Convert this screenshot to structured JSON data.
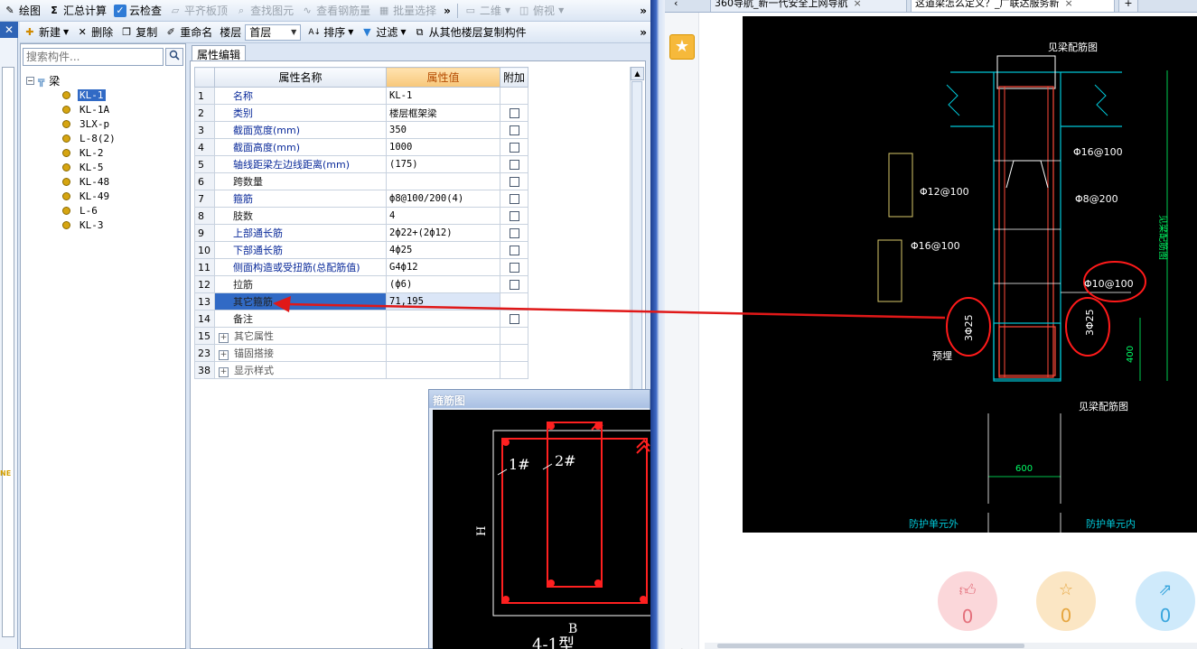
{
  "toolbar1": {
    "draw": "绘图",
    "sum": "汇总计算",
    "cloud_check": "云检查",
    "flatten_slab": "平齐板顶",
    "find_element": "查找图元",
    "view_rebar": "查看钢筋量",
    "batch_select": "批量选择",
    "view_2d": "二维",
    "view_top": "俯视",
    "more": "»"
  },
  "toolbar2": {
    "new": "新建",
    "delete": "删除",
    "copy": "复制",
    "rename": "重命名",
    "floor_label": "楼层",
    "floor_value": "首层",
    "sort": "排序",
    "filter": "过滤",
    "copy_from_floor": "从其他楼层复制构件",
    "more": "»"
  },
  "edge": {
    "close": "✕",
    "ne": "NE"
  },
  "tree": {
    "search_placeholder": "搜索构件...",
    "root": "梁",
    "items": [
      "KL-1",
      "KL-1A",
      "3LX-p",
      "L-8(2)",
      "KL-2",
      "KL-5",
      "KL-48",
      "KL-49",
      "L-6",
      "KL-3"
    ]
  },
  "props": {
    "tab": "属性编辑",
    "headers": {
      "name": "属性名称",
      "value": "属性值",
      "extra": "附加"
    },
    "rows": [
      {
        "n": "1",
        "name": "名称",
        "value": "KL-1",
        "cb": false
      },
      {
        "n": "2",
        "name": "类别",
        "value": "楼层框架梁",
        "cb": true
      },
      {
        "n": "3",
        "name": "截面宽度(mm)",
        "value": "350",
        "cb": true
      },
      {
        "n": "4",
        "name": "截面高度(mm)",
        "value": "1000",
        "cb": true
      },
      {
        "n": "5",
        "name": "轴线距梁左边线距离(mm)",
        "value": "(175)",
        "cb": true
      },
      {
        "n": "6",
        "name": "跨数量",
        "value": "",
        "cb": true
      },
      {
        "n": "7",
        "name": "箍筋",
        "value": "ф8@100/200(4)",
        "cb": true
      },
      {
        "n": "8",
        "name": "肢数",
        "value": "4",
        "cb": true
      },
      {
        "n": "9",
        "name": "上部通长筋",
        "value": "2ф22+(2ф12)",
        "cb": true
      },
      {
        "n": "10",
        "name": "下部通长筋",
        "value": "4ф25",
        "cb": true
      },
      {
        "n": "11",
        "name": "侧面构造或受扭筋(总配筋值)",
        "value": "G4ф12",
        "cb": true
      },
      {
        "n": "12",
        "name": "拉筋",
        "value": "(ф6)",
        "cb": true
      },
      {
        "n": "13",
        "name": "其它箍筋",
        "value": "71,195",
        "cb": false
      },
      {
        "n": "14",
        "name": "备注",
        "value": "",
        "cb": true
      },
      {
        "n": "15",
        "name": "其它属性",
        "value": "",
        "cb": false
      },
      {
        "n": "23",
        "name": "锚固搭接",
        "value": "",
        "cb": false
      },
      {
        "n": "38",
        "name": "显示样式",
        "value": "",
        "cb": false
      }
    ]
  },
  "stirrup": {
    "title": "箍筋图",
    "label_1": "1#",
    "label_2": "2#",
    "label_h": "H",
    "label_b": "B",
    "type": "4-1型"
  },
  "browser": {
    "tab1": "360导航_新一代安全上网导航",
    "tab2": "这道梁怎么定义？_广联达服务新",
    "tab_close": "×",
    "tab_add": "+",
    "sidebar_plus": "+",
    "like_count": "0",
    "fav_count": "0",
    "share_count": "0"
  },
  "cad": {
    "top_label": "见梁配筋图",
    "bottom_label": "见梁配筋图",
    "phi16_100_a": "Φ16@100",
    "phi12_100": "Φ12@100",
    "phi8_200": "Φ8@200",
    "phi16_100_b": "Φ16@100",
    "phi10_100": "Φ10@100",
    "bars_left": "3Φ25",
    "bars_right": "3Φ25",
    "embed": "预埋",
    "dim_400": "400",
    "dim_600": "600",
    "side_label": "见梁配筋图",
    "bottom_left": "防护单元外",
    "bottom_right": "防护单元内"
  },
  "colors": {
    "selection": "#316ac5",
    "header_value": "#f7c77a",
    "arrow": "#e01818",
    "cad_bg": "#000000"
  }
}
